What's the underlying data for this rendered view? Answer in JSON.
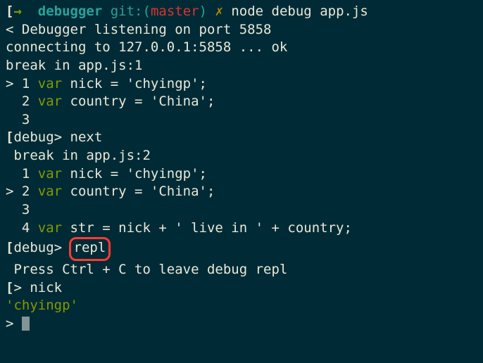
{
  "prompt1": {
    "bracket_open": "[",
    "arrow": "→",
    "dir": "  debugger",
    "git_label": " git:(",
    "branch": "master",
    "git_close": ")",
    "dirty": " ✗ ",
    "cmd": "node debug app.js"
  },
  "output": {
    "line1": "< Debugger listening on port 5858",
    "line2": "connecting to 127.0.0.1:5858 ... ok",
    "break1": "break in app.js:1",
    "src1_prefix": "> 1 ",
    "src1_var": "var",
    "src1_rest": " nick = 'chyingp';",
    "src2_prefix": "  2 ",
    "src2_var": "var",
    "src2_rest": " country = 'China';",
    "src3_prefix": "  3",
    "debug1_bracket": "[",
    "debug1_label": "debug> ",
    "debug1_cmd": "next",
    "break2": "break in app.js:2",
    "src4_prefix": "  1 ",
    "src4_var": "var",
    "src4_rest": " nick = 'chyingp';",
    "src5_prefix": "> 2 ",
    "src5_var": "var",
    "src5_rest": " country = 'China';",
    "src6_prefix": "  3",
    "src7_prefix": "  4 ",
    "src7_var": "var",
    "src7_rest": " str = nick + ' live in ' + country;",
    "debug2_bracket": "[",
    "debug2_label": "debug> ",
    "debug2_cmd": "repl",
    "repl_hint": "Press Ctrl + C to leave debug repl",
    "repl_prompt_bracket": "[",
    "repl_prompt_gt": "> ",
    "repl_cmd": "nick",
    "repl_result": "'chyingp'",
    "final_prompt": "> "
  }
}
